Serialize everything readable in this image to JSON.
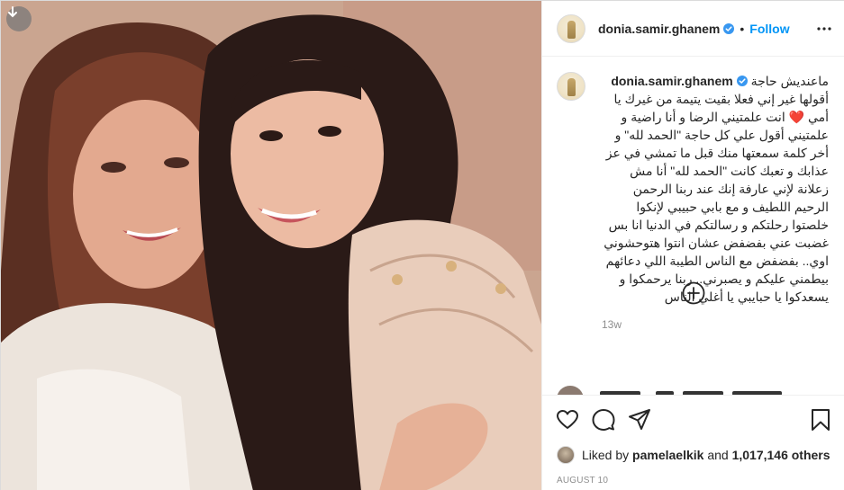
{
  "post": {
    "username": "donia.samir.ghanem",
    "follow_label": "Follow",
    "separator": "•",
    "caption": {
      "line1": "ماعنديش حاجة",
      "line2a": "أقولها غير إني فعلا بقيت يتيمة من غيرك يا أمي",
      "heart": "❤️",
      "line2b": "انت علمتيني الرضا و أنا راضية و علمتيني أقول علي كل حاجة \"الحمد لله\" و أخر كلمة سمعتها منك قبل ما تمشي في عز عذابك و تعبك كانت \"الحمد لله\" أنا مش زعلانة لإني عارفة إنك عند ربنا الرحمن الرحيم اللطيف و مع بابي حبيبي لإنكوا خلصتوا رحلتكم و رسالتكم في الدنيا انا بس غضبت عني بفضفض عشان انتوا هتوحشوني اوي.. بفضفض مع الناس الطيبة اللي دعائهم بيطمني عليكم و يصبرني.. ربنا يرحمكوا و يسعدكوا يا حبايبي يا أغلي الناس"
    },
    "age": "13w",
    "likes": {
      "prefix": "Liked by",
      "user": "pamelaelkik",
      "and": "and",
      "count": "1,017,146 others"
    },
    "date": "AUGUST 10"
  },
  "icons": {
    "download": "download-arrow-icon",
    "more": "more-options-icon",
    "verified": "verified-badge-icon",
    "add": "add-comment-icon",
    "like": "heart-icon",
    "comment": "comment-icon",
    "share": "share-icon",
    "save": "bookmark-icon"
  },
  "colors": {
    "accent": "#0095f6",
    "text": "#262626",
    "muted": "#8e8e8e",
    "border": "#dbdbdb"
  }
}
